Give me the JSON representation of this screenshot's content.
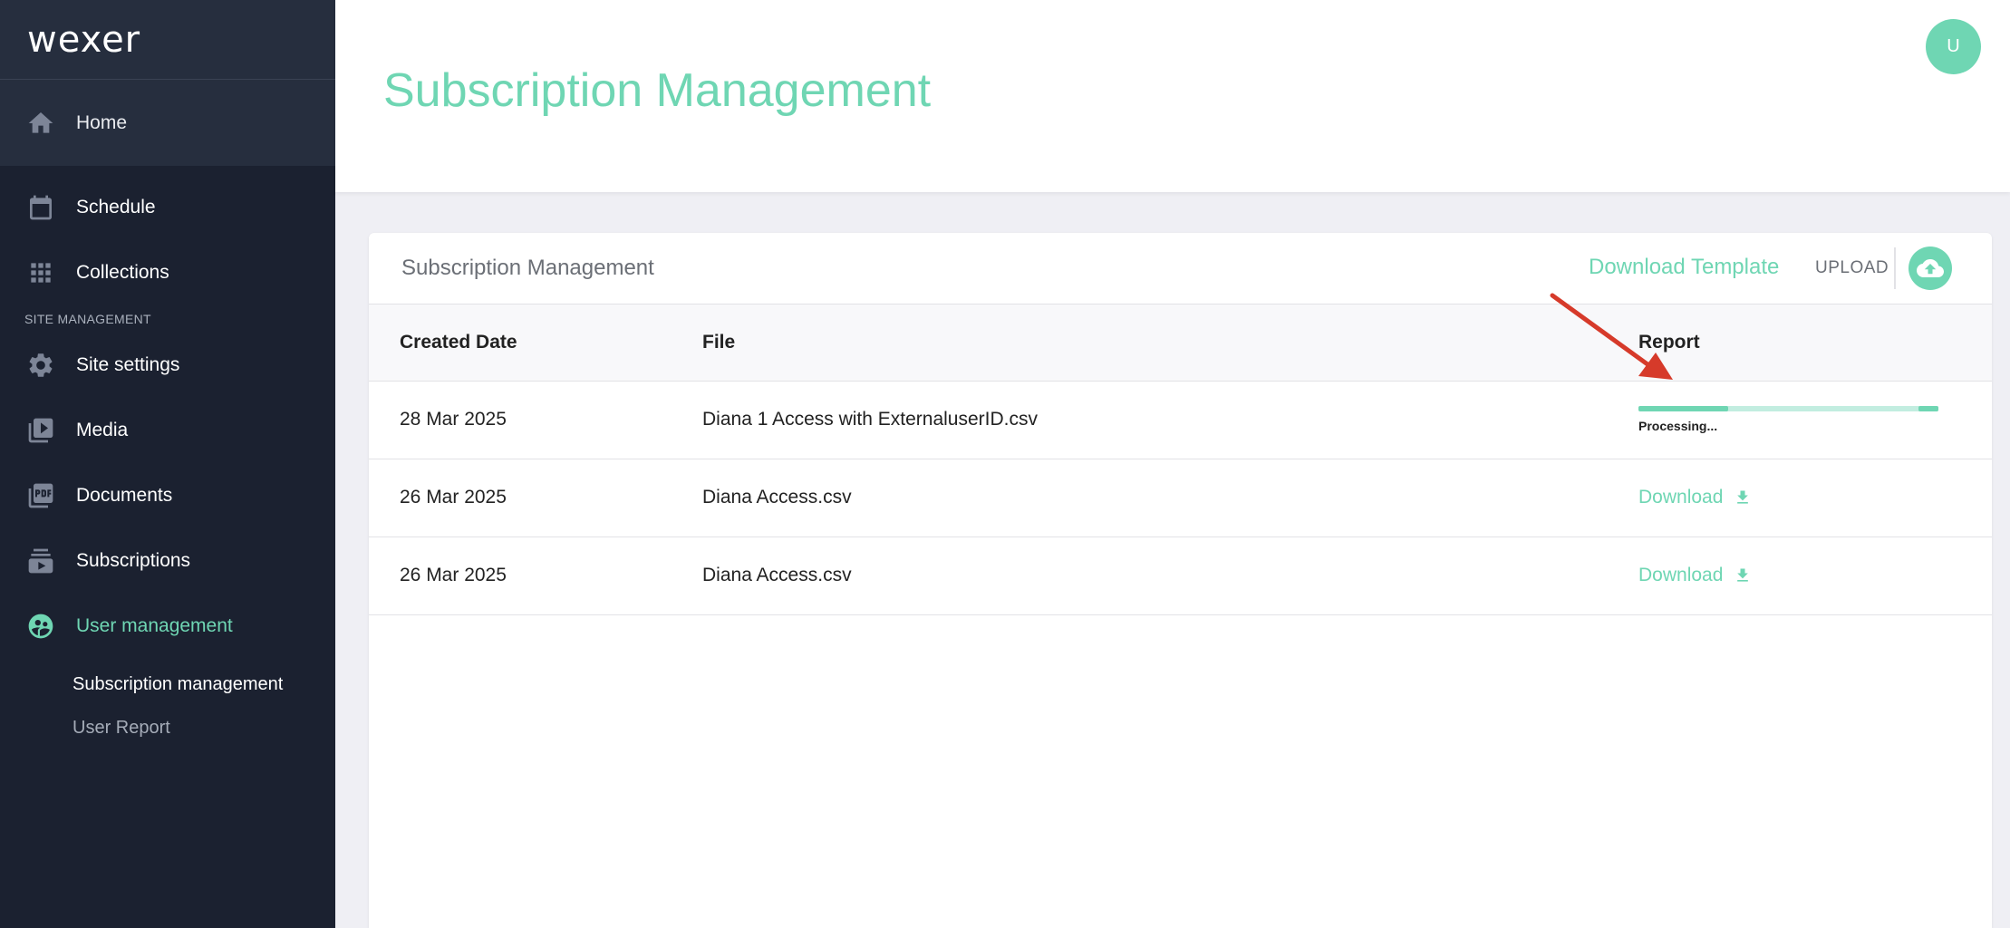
{
  "sidebar": {
    "logo": "wexer",
    "home_label": "Home",
    "items": [
      {
        "label": "Schedule",
        "icon": "calendar-icon"
      },
      {
        "label": "Collections",
        "icon": "grid-icon"
      }
    ],
    "section_label": "SITE MANAGEMENT",
    "mgmt_items": [
      {
        "label": "Site settings",
        "icon": "gear-icon"
      },
      {
        "label": "Media",
        "icon": "video-library-icon"
      },
      {
        "label": "Documents",
        "icon": "pdf-icon"
      },
      {
        "label": "Subscriptions",
        "icon": "subscriptions-icon"
      },
      {
        "label": "User management",
        "icon": "user-group-icon",
        "active": true
      }
    ],
    "sub_items": [
      {
        "label": "Subscription management",
        "current": true
      },
      {
        "label": "User Report"
      }
    ]
  },
  "header": {
    "title": "Subscription Management",
    "avatar_initial": "U"
  },
  "card": {
    "title": "Subscription Management",
    "download_template": "Download Template",
    "upload": "UPLOAD",
    "columns": [
      "Created Date",
      "File",
      "Report"
    ],
    "rows": [
      {
        "date": "28 Mar 2025",
        "file": "Diana 1 Access with ExternaluserID.csv",
        "status": "Processing...",
        "progress": 0.3
      },
      {
        "date": "26 Mar 2025",
        "file": "Diana Access.csv",
        "report": "Download"
      },
      {
        "date": "26 Mar 2025",
        "file": "Diana Access.csv",
        "report": "Download"
      }
    ]
  },
  "colors": {
    "accent": "#6fd6b3",
    "sidebar_bg": "#1b2130",
    "annotation_arrow": "#d63a2a"
  }
}
